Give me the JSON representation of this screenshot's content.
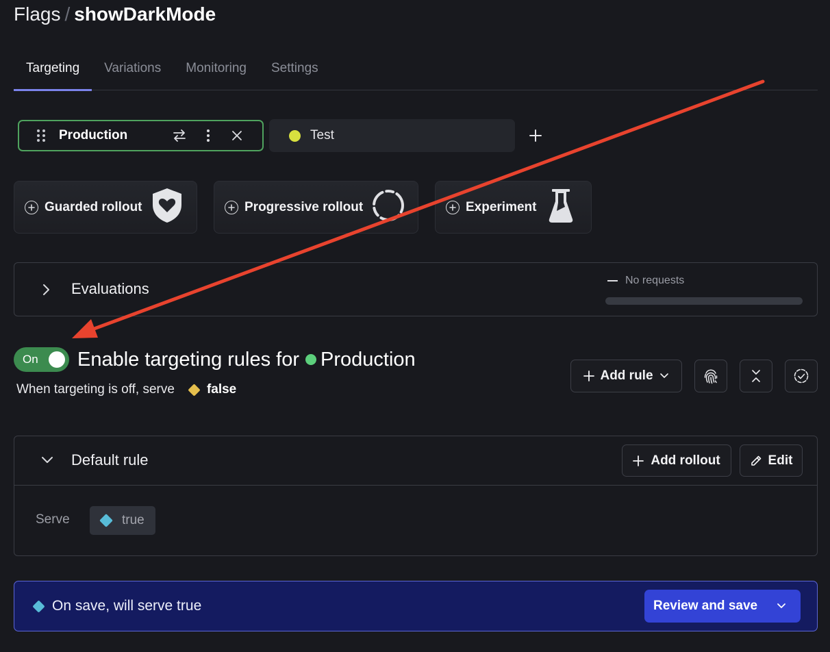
{
  "header": {
    "breadcrumb_root": "Flags",
    "separator": "/",
    "flag_key": "showDarkMode"
  },
  "tabs": [
    {
      "label": "Targeting",
      "active": true
    },
    {
      "label": "Variations",
      "active": false
    },
    {
      "label": "Monitoring",
      "active": false
    },
    {
      "label": "Settings",
      "active": false
    }
  ],
  "environments": {
    "selected": {
      "label": "Production",
      "color": "#5ccf7c"
    },
    "other": {
      "label": "Test",
      "color": "#d8e03f"
    },
    "icons": [
      "drag-handle-icon",
      "swap-icon",
      "more-vertical-icon",
      "close-icon"
    ],
    "add_icon": "plus-icon"
  },
  "feature_cards": [
    {
      "label": "Guarded rollout",
      "icon": "shield-heart-icon"
    },
    {
      "label": "Progressive rollout",
      "icon": "dashed-circle-icon"
    },
    {
      "label": "Experiment",
      "icon": "flask-icon"
    }
  ],
  "evaluations": {
    "title": "Evaluations",
    "status": "No requests",
    "progress": 0
  },
  "targeting": {
    "toggle_label": "On",
    "enabled": true,
    "title_prefix": "Enable targeting rules for",
    "environment": "Production",
    "off_text": "When targeting is off, serve",
    "off_value": "false",
    "off_value_color": "#e5bf4d",
    "add_rule_label": "Add rule",
    "icon_buttons": [
      "fingerprint-icon",
      "collapse-all-icon",
      "check-circle-dashed-icon"
    ]
  },
  "default_rule": {
    "title": "Default rule",
    "add_rollout_label": "Add rollout",
    "edit_label": "Edit",
    "serve_label": "Serve",
    "serve_value": "true",
    "serve_value_color": "#58bcd8"
  },
  "save_banner": {
    "message": "On save, will serve true",
    "button_label": "Review and save"
  },
  "annotation": {
    "type": "arrow",
    "color": "#e8432e"
  }
}
